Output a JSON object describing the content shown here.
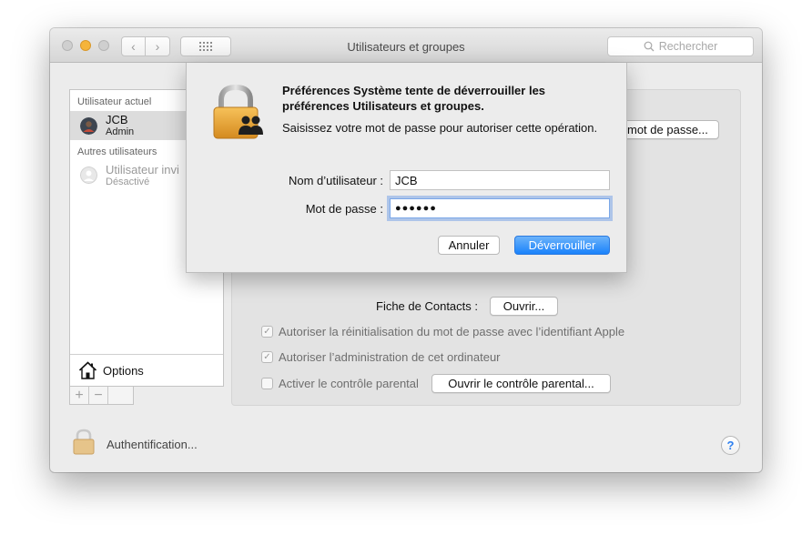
{
  "window": {
    "title": "Utilisateurs et groupes"
  },
  "toolbar": {
    "back": "‹",
    "forward": "›",
    "search_placeholder": "Rechercher"
  },
  "sidebar": {
    "current_header": "Utilisateur actuel",
    "current_user": {
      "name": "JCB",
      "role": "Admin"
    },
    "others_header": "Autres utilisateurs",
    "guest_user": {
      "name": "Utilisateur invi",
      "role": "Désactivé"
    },
    "options_label": "Options",
    "add": "+",
    "remove": "−"
  },
  "pane": {
    "change_password_button": "mot de passe...",
    "contacts_label": "Fiche de Contacts :",
    "contacts_button": "Ouvrir...",
    "allow_reset_label": "Autoriser la réinitialisation du mot de passe avec l’identifiant Apple",
    "allow_reset_checked": true,
    "allow_admin_label": "Autoriser l’administration de cet ordinateur",
    "allow_admin_checked": true,
    "parental_label": "Activer le contrôle parental",
    "parental_checked": false,
    "parental_button": "Ouvrir le contrôle parental..."
  },
  "footer": {
    "auth_label": "Authentification...",
    "help": "?"
  },
  "dialog": {
    "title": "Préférences Système tente de déverrouiller les préférences Utilisateurs et groupes.",
    "message": "Saisissez votre mot de passe pour autoriser cette opération.",
    "username_label": "Nom d’utilisateur :",
    "username_value": "JCB",
    "password_label": "Mot de passe :",
    "password_value": "●●●●●●",
    "cancel_button": "Annuler",
    "unlock_button": "Déverrouiller"
  },
  "colors": {
    "accent": "#1a82fb",
    "lock_gold": "#e9a33a",
    "traffic_min": "#f5b43a"
  }
}
